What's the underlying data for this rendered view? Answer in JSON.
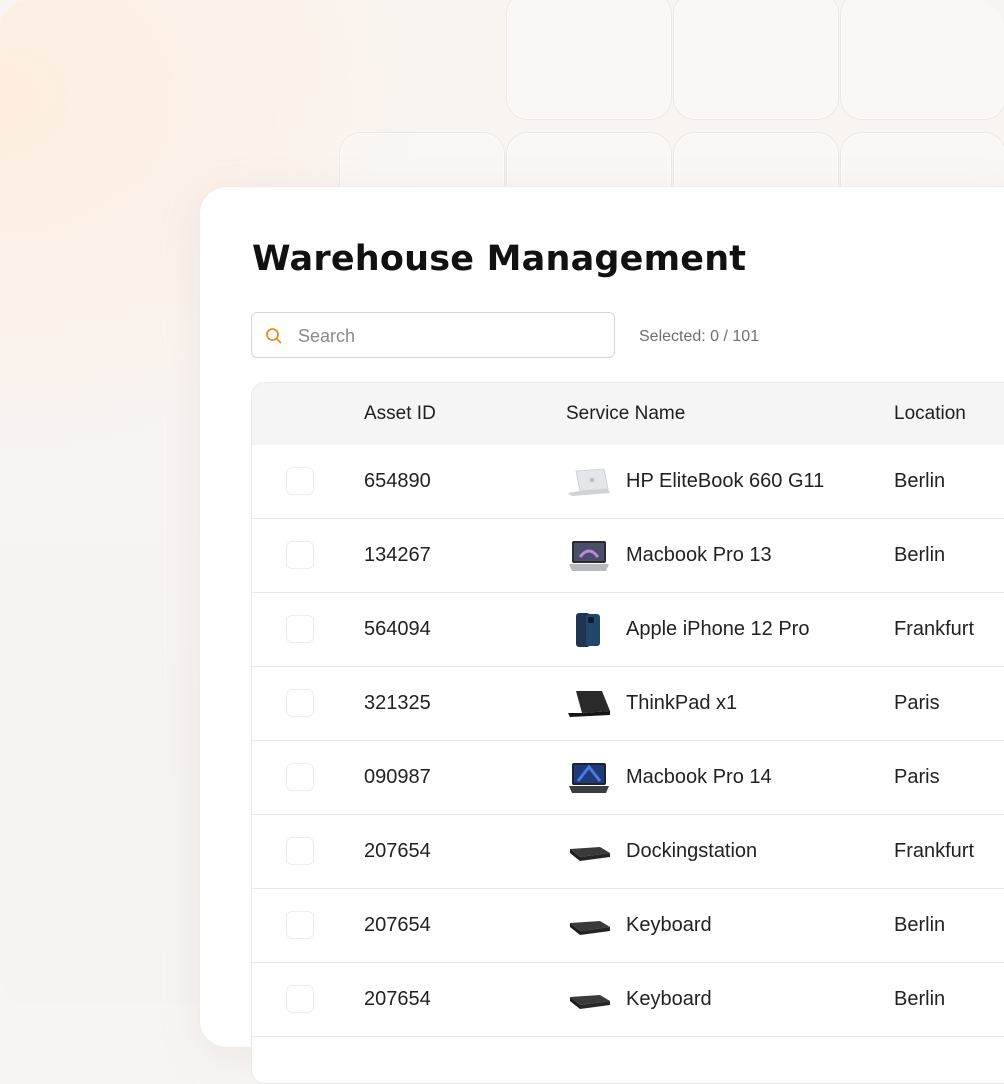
{
  "page": {
    "title": "Warehouse Management",
    "search": {
      "placeholder": "Search",
      "value": ""
    },
    "selected_text": "Selected: 0 / 101"
  },
  "table": {
    "columns": [
      "",
      "Asset ID",
      "Service Name",
      "Location"
    ],
    "rows": [
      {
        "checked": false,
        "asset_id": "654890",
        "name": "HP EliteBook 660 G11",
        "icon": "silver-laptop-icon",
        "location": "Berlin"
      },
      {
        "checked": false,
        "asset_id": "134267",
        "name": "Macbook Pro 13",
        "icon": "macbook-icon",
        "location": "Berlin"
      },
      {
        "checked": false,
        "asset_id": "564094",
        "name": "Apple iPhone 12 Pro",
        "icon": "iphone-icon",
        "location": "Frankfurt"
      },
      {
        "checked": false,
        "asset_id": "321325",
        "name": "ThinkPad x1",
        "icon": "black-laptop-icon",
        "location": "Paris"
      },
      {
        "checked": false,
        "asset_id": "090987",
        "name": "Macbook Pro 14",
        "icon": "macbook-dark-icon",
        "location": "Paris"
      },
      {
        "checked": false,
        "asset_id": "207654",
        "name": "Dockingstation",
        "icon": "docking-station-icon",
        "location": "Frankfurt"
      },
      {
        "checked": false,
        "asset_id": "207654",
        "name": "Keyboard",
        "icon": "keyboard-icon",
        "location": "Berlin"
      },
      {
        "checked": false,
        "asset_id": "207654",
        "name": "Keyboard",
        "icon": "keyboard-icon",
        "location": "Berlin"
      }
    ]
  },
  "colors": {
    "accent": "#f08a24",
    "title": "#111111",
    "border": "#ebe9e8"
  }
}
